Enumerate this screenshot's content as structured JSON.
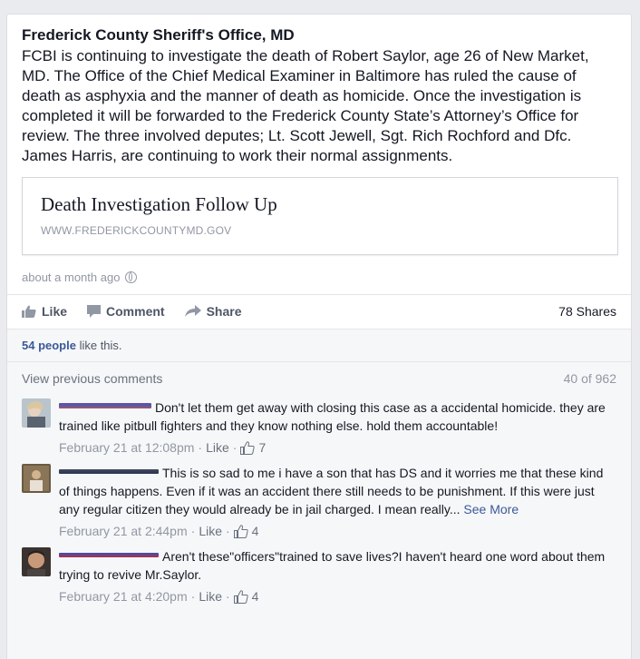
{
  "post": {
    "page_name": "Frederick County Sheriff's Office, MD",
    "text": "FCBI is continuing to investigate the death of Robert Saylor, age 26 of New Market, MD. The Office of the Chief Medical Examiner in Baltimore has ruled the cause of death as asphyxia and the manner of death as homicide. Once the investigation is completed it will be forwarded to the Frederick County State’s Attorney’s Office for review. The three involved deputes; Lt. Scott Jewell, Sgt. Rich Rochford and Dfc. James Harris, are continuing to work their normal assignments.",
    "link": {
      "title": "Death Investigation Follow Up",
      "domain": "WWW.FREDERICKCOUNTYMD.GOV"
    },
    "timestamp": "about a month ago",
    "timestamp_icon": "globe-icon"
  },
  "actions": {
    "like": "Like",
    "comment": "Comment",
    "share": "Share",
    "shares_count": "78 Shares"
  },
  "likes": {
    "count": "54 people",
    "suffix": " like this."
  },
  "comments_header": {
    "view_previous": "View previous comments",
    "count": "40 of 962"
  },
  "comments": [
    {
      "text": "Don't let them get away with closing this case as a accidental homicide. they are trained like pitbull fighters and they know nothing else. hold them accountable!",
      "time": "February 21 at 12:08pm",
      "like_label": "Like",
      "likes": "7"
    },
    {
      "text": "This is so sad to me i have a son that has DS and it worries me that these kind of things happens. Even if it was an accident there still needs to be punishment. If this were just any regular citizen they would already be in jail charged. I mean really...",
      "see_more": "See More",
      "time": "February 21 at 2:44pm",
      "like_label": "Like",
      "likes": "4"
    },
    {
      "text": "Aren't these\"officers\"trained to save lives?I haven't heard one word about them trying to revive Mr.Saylor.",
      "time": "February 21 at 4:20pm",
      "like_label": "Like",
      "likes": "4"
    }
  ],
  "colors": {
    "link_blue": "#3b5998",
    "muted": "#9197a3",
    "background": "#e9ebee"
  }
}
